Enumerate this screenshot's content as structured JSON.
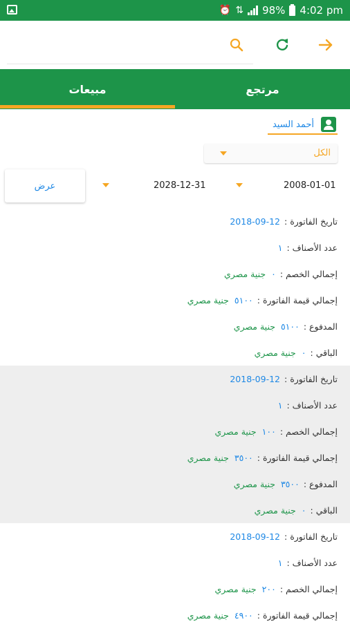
{
  "status_bar": {
    "battery": "98%",
    "time": "4:02 pm",
    "icons": [
      "image-icon",
      "alarm-icon",
      "data-arrows-icon",
      "signal-icon",
      "battery-icon"
    ]
  },
  "toolbar": {
    "icons": [
      "search-icon",
      "refresh-icon",
      "forward-arrow-icon"
    ],
    "colors": {
      "search": "#f5a623",
      "refresh": "#1d9449",
      "forward": "#f5a623"
    }
  },
  "tabs": {
    "returns": "مرتجع",
    "sales": "مبيعات",
    "selected": "sales"
  },
  "customer": {
    "name": "أحمد السيد"
  },
  "filter": {
    "value": "الكل"
  },
  "date_range": {
    "from": "2008-01-01",
    "to": "2028-12-31"
  },
  "show_button": "عرض",
  "labels": {
    "invoice_date": "تاريخ الفاتورة",
    "items_count": "عدد الأصناف",
    "total_discount": "إجمالي الخصم",
    "total_value": "إجمالي قيمة الفاتورة",
    "paid": "المدفوع",
    "remaining": "الباقي",
    "currency": "جنية مصري"
  },
  "invoices": [
    {
      "date": "2018-09-12",
      "items": "١",
      "discount": "٠",
      "total": "٥١٠٠",
      "paid": "٥١٠٠",
      "remaining": "٠"
    },
    {
      "date": "2018-09-12",
      "items": "١",
      "discount": "١٠٠",
      "total": "٣٥٠٠",
      "paid": "٣٥٠٠",
      "remaining": "٠"
    },
    {
      "date": "2018-09-12",
      "items": "١",
      "discount": "٢٠٠",
      "total": "٤٩٠٠"
    }
  ],
  "colors": {
    "primary": "#1d9449",
    "accent": "#f5a623",
    "link": "#1e88e5",
    "shaded_row": "#eeeeee"
  }
}
